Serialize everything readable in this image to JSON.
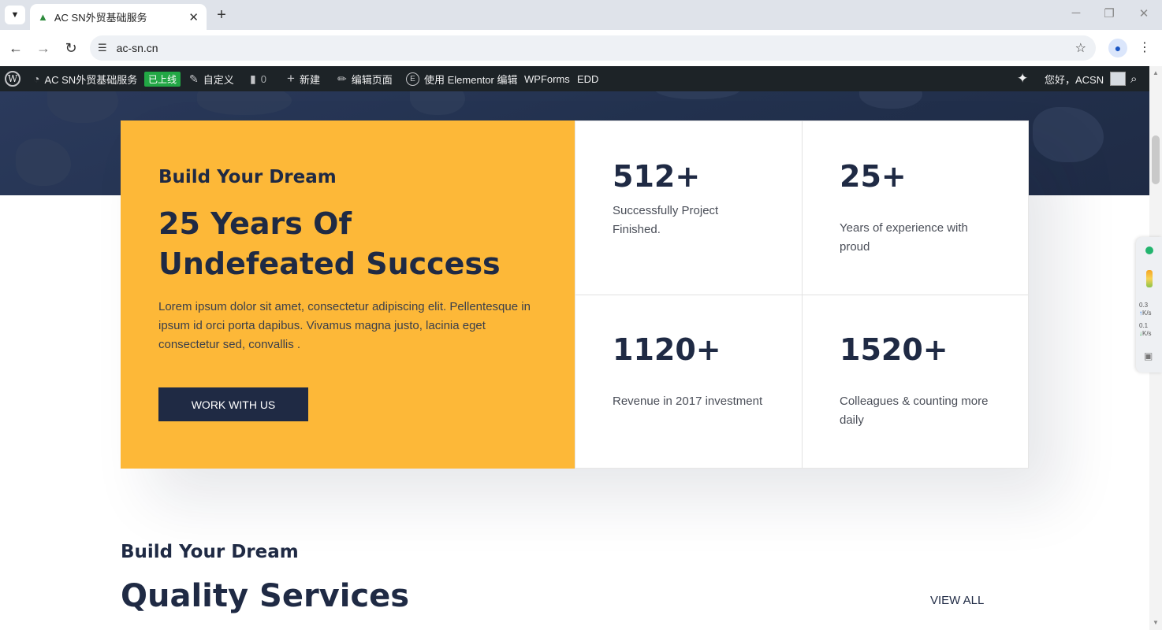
{
  "browser": {
    "tab_title": "AC SN外贸基础服务",
    "url": "ac-sn.cn",
    "icons": {
      "tab_menu": "chevron-down-icon",
      "favicon": "tree-icon",
      "close_tab": "close-icon",
      "new_tab": "plus-icon",
      "back": "arrow-left-icon",
      "forward": "arrow-right-icon",
      "reload": "reload-icon",
      "site_info": "tune-icon",
      "bookmark": "star-icon",
      "profile": "person-icon",
      "menu": "kebab-icon"
    }
  },
  "adminbar": {
    "site_name": "AC SN外贸基础服务",
    "status_badge": "已上线",
    "customize": "自定义",
    "comments_count": "0",
    "new_label": "新建",
    "edit_page": "编辑页面",
    "elementor": "使用 Elementor 编辑",
    "wpforms": "WPForms",
    "edd": "EDD",
    "greeting": "您好，ACSN",
    "status_color": "#22a745"
  },
  "hero": {
    "eyebrow": "Build Your Dream",
    "title": "25 Years Of Undefeated Success",
    "body": "Lorem ipsum dolor sit amet, consectetur adipiscing elit. Pellentesque in ipsum id orci porta dapibus. Vivamus magna justo, lacinia eget consectetur sed, convallis .",
    "cta": "WORK WITH US",
    "accent_color": "#fdb838",
    "dark_color": "#1f2a44"
  },
  "stats": [
    {
      "number": "512+",
      "caption": "Successfully Project Finished."
    },
    {
      "number": "25+",
      "caption": "Years of experience with proud"
    },
    {
      "number": "1120+",
      "caption": "Revenue in 2017 investment"
    },
    {
      "number": "1520+",
      "caption": "Colleagues & counting more daily"
    }
  ],
  "services": {
    "eyebrow": "Build Your Dream",
    "title": "Quality Services",
    "view_all": "VIEW ALL"
  },
  "monitor": {
    "upload": "0.3",
    "download": "0.1",
    "unit": "K/s"
  }
}
